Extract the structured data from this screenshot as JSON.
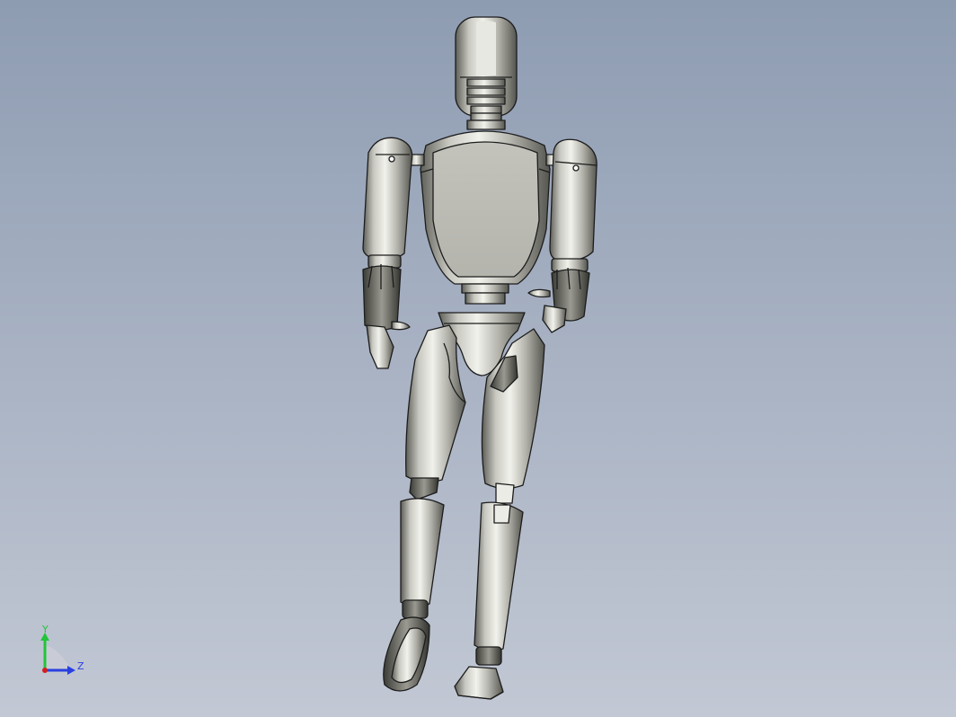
{
  "viewport": {
    "background_top": "#8e9cb2",
    "background_bottom": "#c2c8d4",
    "model_color": "#b9b9b2",
    "edge_color": "#1c1c1c"
  },
  "triad": {
    "y_label": "Y",
    "z_label": "Z",
    "y_color": "#22c43a",
    "z_color": "#2a3fe0",
    "x_color": "#d41e1e"
  }
}
